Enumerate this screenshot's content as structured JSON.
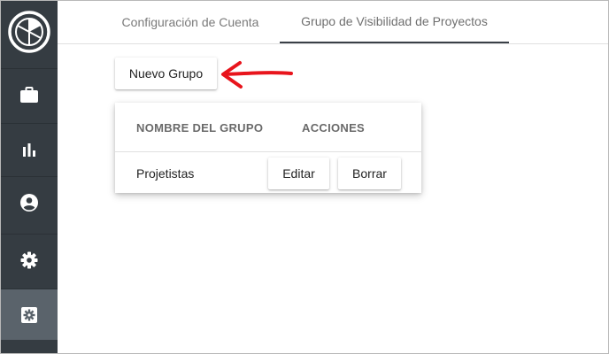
{
  "sidebar": {
    "logo": "logo-icon",
    "items": [
      {
        "icon": "briefcase-icon"
      },
      {
        "icon": "bar-chart-icon"
      },
      {
        "icon": "account-circle-icon"
      },
      {
        "icon": "gear-icon"
      },
      {
        "icon": "settings-box-icon",
        "active": true
      }
    ]
  },
  "tabs": [
    {
      "label": "Configuración de Cuenta"
    },
    {
      "label": "Grupo de Visibilidad de Proyectos",
      "active": true
    }
  ],
  "new_group_label": "Nuevo Grupo",
  "table": {
    "columns": [
      "NOMBRE DEL GRUPO",
      "ACCIONES"
    ],
    "rows": [
      {
        "name": "Projetistas",
        "actions": [
          "Editar",
          "Borrar"
        ]
      }
    ]
  },
  "colors": {
    "sidebar": "#353c42",
    "sidebar_active": "#5a636b",
    "annotation_arrow": "#e8141c"
  }
}
